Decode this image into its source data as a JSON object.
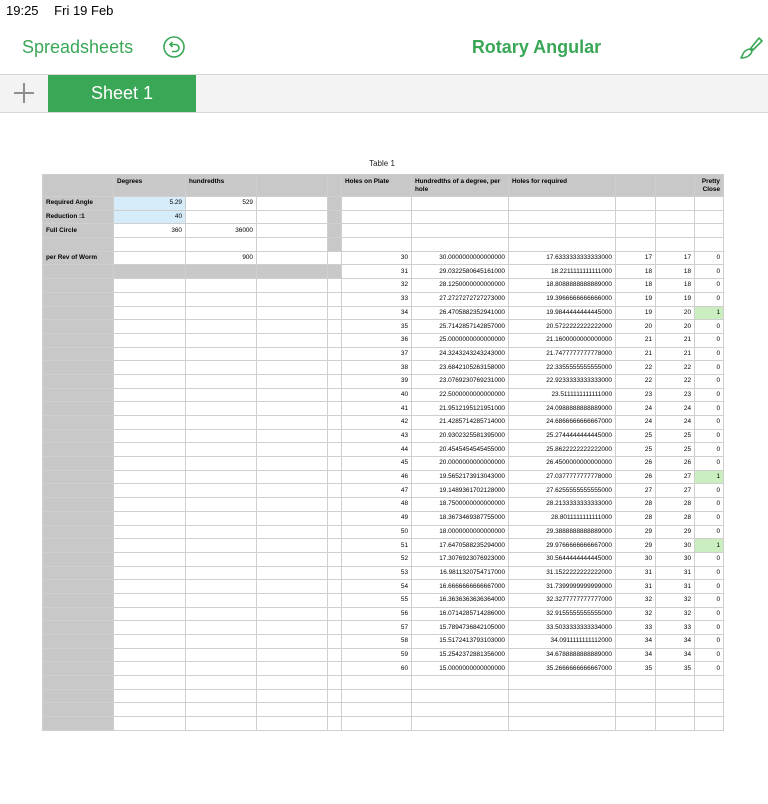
{
  "status": {
    "time": "19:25",
    "date": "Fri 19 Feb"
  },
  "nav": {
    "back_label": "Spreadsheets",
    "title": "Rotary Angular"
  },
  "tabs": [
    {
      "label": "Sheet 1"
    }
  ],
  "table": {
    "title": "Table 1",
    "headers": [
      "",
      "Degrees",
      "hundredths",
      "",
      "Holes on Plate",
      "Hundredths  of a  degree, per hole",
      "Holes for required",
      "",
      "",
      "Pretty Close"
    ],
    "params": [
      {
        "label": "Required Angle",
        "degrees": "5.29",
        "hundredths": "529"
      },
      {
        "label": "Reduction :1",
        "value": "40"
      },
      {
        "label": "Full Circle",
        "degrees": "360",
        "hundredths": "36000"
      },
      {
        "label": "per Rev of Worm",
        "hundredths": "900"
      }
    ],
    "rows": [
      [
        "30",
        "30.0000000000000000",
        "17.6333333333333000",
        "17",
        "17",
        "0"
      ],
      [
        "31",
        "29.0322580645161000",
        "18.2211111111111000",
        "18",
        "18",
        "0"
      ],
      [
        "32",
        "28.1250000000000000",
        "18.8088888888889000",
        "18",
        "18",
        "0"
      ],
      [
        "33",
        "27.2727272727273000",
        "19.3966666666666000",
        "19",
        "19",
        "0"
      ],
      [
        "34",
        "26.4705882352941000",
        "19.9844444444445000",
        "19",
        "20",
        "1"
      ],
      [
        "35",
        "25.7142857142857000",
        "20.5722222222222000",
        "20",
        "20",
        "0"
      ],
      [
        "36",
        "25.0000000000000000",
        "21.1600000000000000",
        "21",
        "21",
        "0"
      ],
      [
        "37",
        "24.3243243243243000",
        "21.7477777777778000",
        "21",
        "21",
        "0"
      ],
      [
        "38",
        "23.6842105263158000",
        "22.3355555555555000",
        "22",
        "22",
        "0"
      ],
      [
        "39",
        "23.0769230769231000",
        "22.9233333333333000",
        "22",
        "22",
        "0"
      ],
      [
        "40",
        "22.5000000000000000",
        "23.5111111111111000",
        "23",
        "23",
        "0"
      ],
      [
        "41",
        "21.9512195121951000",
        "24.0988888888889000",
        "24",
        "24",
        "0"
      ],
      [
        "42",
        "21.4285714285714000",
        "24.6866666666667000",
        "24",
        "24",
        "0"
      ],
      [
        "43",
        "20.9302325581395000",
        "25.2744444444445000",
        "25",
        "25",
        "0"
      ],
      [
        "44",
        "20.4545454545455000",
        "25.8622222222222000",
        "25",
        "25",
        "0"
      ],
      [
        "45",
        "20.0000000000000000",
        "26.4500000000000000",
        "26",
        "26",
        "0"
      ],
      [
        "46",
        "19.5652173913043000",
        "27.0377777777778000",
        "26",
        "27",
        "1"
      ],
      [
        "47",
        "19.1489361702128000",
        "27.6255555555555000",
        "27",
        "27",
        "0"
      ],
      [
        "48",
        "18.7500000000000000",
        "28.2133333333333000",
        "28",
        "28",
        "0"
      ],
      [
        "49",
        "18.3673469387755000",
        "28.8011111111111000",
        "28",
        "28",
        "0"
      ],
      [
        "50",
        "18.0000000000000000",
        "29.3888888888889000",
        "29",
        "29",
        "0"
      ],
      [
        "51",
        "17.6470588235294000",
        "29.9766666666667000",
        "29",
        "30",
        "1"
      ],
      [
        "52",
        "17.3076923076923000",
        "30.5644444444445000",
        "30",
        "30",
        "0"
      ],
      [
        "53",
        "16.9811320754717000",
        "31.1522222222222000",
        "31",
        "31",
        "0"
      ],
      [
        "54",
        "16.6666666666667000",
        "31.7399999999999000",
        "31",
        "31",
        "0"
      ],
      [
        "55",
        "16.3636363636364000",
        "32.3277777777777000",
        "32",
        "32",
        "0"
      ],
      [
        "56",
        "16.0714285714286000",
        "32.9155555555555000",
        "32",
        "32",
        "0"
      ],
      [
        "57",
        "15.7894736842105000",
        "33.5033333333334000",
        "33",
        "33",
        "0"
      ],
      [
        "58",
        "15.5172413793103000",
        "34.0911111111112000",
        "34",
        "34",
        "0"
      ],
      [
        "59",
        "15.2542372881356000",
        "34.6788888888889000",
        "34",
        "34",
        "0"
      ],
      [
        "60",
        "15.0000000000000000",
        "35.2666666666667000",
        "35",
        "35",
        "0"
      ]
    ]
  },
  "colors": {
    "accent": "#3aa757",
    "header_gray": "#c8c8c8",
    "selected_blue": "#d7ecfa",
    "highlight_green": "#cbeec0"
  },
  "icons": {
    "undo": "undo-icon",
    "brush": "format-brush-icon",
    "add": "plus-icon"
  }
}
